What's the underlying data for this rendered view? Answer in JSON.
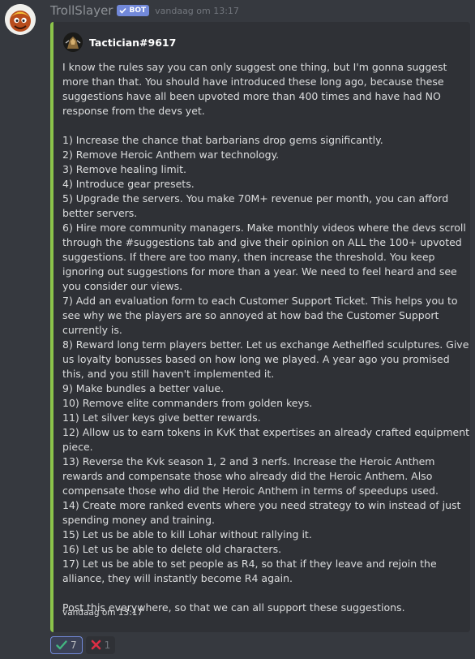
{
  "header": {
    "username": "TrollSlayer",
    "bot_badge": "BOT",
    "timestamp": "vandaag om 13:17"
  },
  "embed": {
    "accent_color": "#8bc34a",
    "author": "Tactician#9617",
    "description": "I know the rules say you can only suggest one thing, but I'm gonna suggest more than that. You should have introduced these long ago, because these suggestions have all been upvoted more than 400 times and have had NO response from the devs yet.\n\n1) Increase the chance that barbarians drop gems significantly.\n2) Remove Heroic Anthem war technology.\n3) Remove healing limit.\n4) Introduce gear presets.\n5) Upgrade the servers. You make 70M+ revenue per month, you can afford better servers.\n6) Hire more community managers. Make monthly videos where the devs scroll through the #suggestions tab and give their opinion on ALL the 100+ upvoted suggestions. If there are too many, then increase the threshold. You keep ignoring out suggestions for more than a year. We need to feel heard and see you consider our views.\n7) Add an evaluation form to each Customer Support Ticket. This helps you to see why we the players are so annoyed at how bad the Customer Support currently is.\n8) Reward long term players better. Let us exchange Aethelfled sculptures. Give us loyalty bonusses based on how long we played. A year ago you promised this, and you still haven't implemented it.\n9) Make bundles a better value.\n10) Remove elite commanders from golden keys.\n11) Let silver keys give better rewards.\n12) Allow us to earn tokens in KvK that expertises an already crafted equipment piece.\n13) Reverse the Kvk season 1, 2 and 3 nerfs. Increase the Heroic Anthem rewards and compensate those who already did the Heroic Anthem. Also compensate those who did the Heroic Anthem in terms of speedups used.\n14) Create more ranked events where you need strategy to win instead of just spending money and training.\n15) Let us be able to kill Lohar without rallying it.\n16) Let us be able to delete old characters.\n17) Let us be able to set people as R4, so that if they leave and rejoin the alliance, they will instantly become R4 again.\n\nPost this everywhere, so that we can all support these suggestions.",
    "footer": "vandaag om 13:17"
  },
  "reactions": [
    {
      "icon": "check-icon",
      "count": "7",
      "active": true
    },
    {
      "icon": "cross-icon",
      "count": "1",
      "active": false
    }
  ],
  "colors": {
    "background": "#36393f",
    "embed_background": "#2f3136",
    "bot_badge": "#7289da",
    "check_green": "#43b581",
    "cross_red": "#dd2e44"
  }
}
